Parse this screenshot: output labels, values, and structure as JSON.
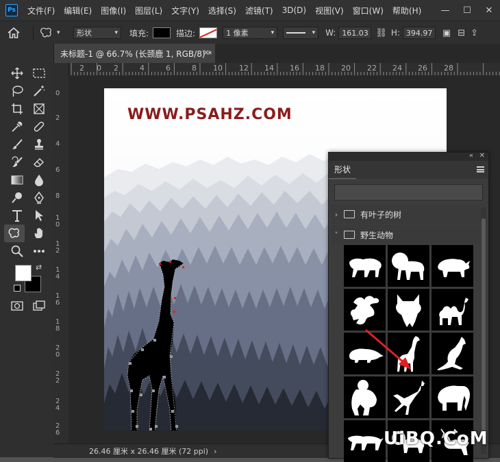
{
  "app": {
    "logo": "Ps"
  },
  "menu": [
    "文件(F)",
    "编辑(E)",
    "图像(I)",
    "图层(L)",
    "文字(Y)",
    "选择(S)",
    "滤镜(T)",
    "3D(D)",
    "视图(V)",
    "窗口(W)",
    "帮助(H)"
  ],
  "window_controls": {
    "minimize": "—",
    "maximize": "☐",
    "close": "✕"
  },
  "options": {
    "mode": "形状",
    "fill_label": "填充:",
    "stroke_label": "描边:",
    "stroke_width": "1 像素",
    "w_label": "W:",
    "w_value": "161.03",
    "h_label": "H:",
    "h_value": "394.97",
    "fill_color": "#000000"
  },
  "document_tab": {
    "title": "未标题-1 @ 66.7% (长颈鹿 1, RGB/8) *",
    "close": "✕"
  },
  "ruler_top": [
    "2",
    "0",
    "2",
    "4",
    "6",
    "8",
    "10",
    "12",
    "14",
    "16",
    "18",
    "20",
    "22",
    "24",
    "26",
    "28"
  ],
  "ruler_left": [
    "0",
    "2",
    "4",
    "6",
    "8",
    "1\n0",
    "1\n2",
    "1\n4",
    "1\n6",
    "1\n8",
    "2\n0",
    "2\n2",
    "2\n4",
    "2\n6"
  ],
  "toolbar_collapse": "«",
  "canvas": {
    "watermark": "WWW.PSAHZ.COM"
  },
  "status": {
    "info": "26.46 厘米 x 26.46 厘米 (72 ppi)",
    "arrow": "›"
  },
  "shapes_panel": {
    "collapse": "«",
    "close": "✕",
    "tab": "形状",
    "menu_icon": "hamburger-icon",
    "groups": [
      {
        "name": "有叶子的树",
        "expanded": false
      },
      {
        "name": "野生动物",
        "expanded": true
      }
    ],
    "animals": [
      "lion",
      "lion-male",
      "rhino",
      "dragon",
      "fox",
      "camel",
      "mole",
      "giraffe",
      "kangaroo",
      "gorilla",
      "deer-leaping",
      "elephant",
      "cheetah",
      "ram",
      "stag"
    ]
  },
  "site_logo": "UiBQ.CoM",
  "colors": {
    "accent": "#31a8ff",
    "watermark": "#8a1c1c",
    "arrow": "#e02020"
  }
}
